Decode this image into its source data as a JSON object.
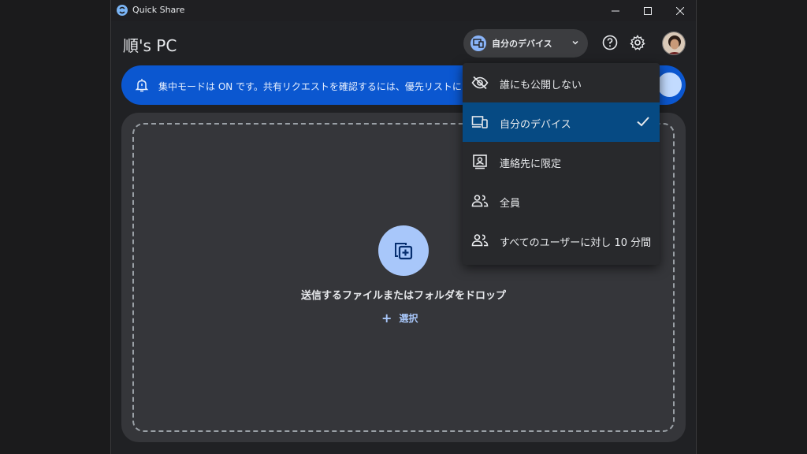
{
  "window": {
    "title": "Quick Share",
    "device_name": "順's PC"
  },
  "header": {
    "visibility_selected": "自分のデバイス",
    "help_icon": "help-icon",
    "settings_icon": "gear-icon",
    "avatar_icon": "avatar"
  },
  "banner": {
    "text": "集中モードは ON です。共有リクエストを確認するには、優先リストに Quick Share"
  },
  "drop": {
    "text": "送信するファイルまたはフォルダをドロップ",
    "select_label": "選択"
  },
  "visibility_menu": {
    "items": [
      {
        "label": "誰にも公開しない",
        "icon": "visibility-off-icon"
      },
      {
        "label": "自分のデバイス",
        "icon": "devices-icon",
        "selected": true
      },
      {
        "label": "連絡先に限定",
        "icon": "contact-card-icon"
      },
      {
        "label": "全員",
        "icon": "people-icon"
      },
      {
        "label": "すべてのユーザーに対し 10 分間",
        "icon": "people-timer-icon"
      }
    ]
  },
  "colors": {
    "banner": "#0b57d0",
    "selected_item": "#064a83",
    "accent": "#a8c7fa"
  }
}
